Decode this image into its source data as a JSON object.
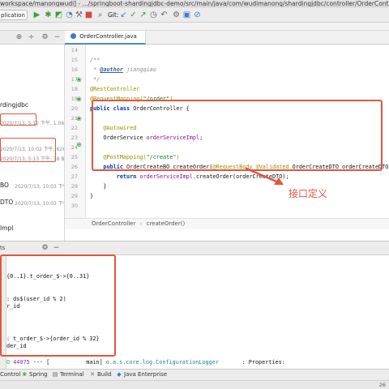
{
  "title_bar": {
    "text": "workspace/manongwudi] - .../springboot-shardingjdbc-demo/src/main/java/com/wudimanong/shardingjdbc/controller/OrderController.java [spring"
  },
  "toolbar": {
    "run_config": "plication",
    "git_label": "Git:",
    "icons": [
      "run-icon",
      "debug-icon",
      "coverage-icon",
      "profile-icon",
      "build-icon",
      "stop-icon",
      "search-icon",
      "git-update-icon",
      "git-commit-icon",
      "git-push-icon",
      "history-icon",
      "revert-icon",
      "settings-icon",
      "layout-icon",
      "block-icon"
    ]
  },
  "project_pane": {
    "header_icons": [
      "scope-icon",
      "split-icon",
      "gear-icon",
      "minimize-icon"
    ],
    "module_name": "rdingjdbc",
    "entries": [
      {
        "meta": "2020/7/13, ",
        "meta_highlight": "5:12 下午, 1.06"
      },
      {
        "meta": "2020/7/13, 10:02 下午, 626 B"
      },
      {
        "meta": "2020/7/13, 5:13 下午, 38 B"
      }
    ],
    "files": [
      {
        "name": "BO",
        "meta": "2020/7/13, 10:03 下午, 1"
      },
      {
        "name": "DTO",
        "meta": "2020/7/13, 10:03 下午,"
      },
      {
        "name": "Impl",
        "meta": ""
      }
    ]
  },
  "editor": {
    "tab_label": "OrderController.java",
    "line_numbers": [
      "14",
      "15",
      "16",
      "17",
      "18",
      "19",
      "20",
      "21",
      "22",
      "23",
      "24",
      "25",
      "26",
      "27",
      "28",
      "29",
      "30"
    ],
    "lines": {
      "l15": "/**",
      "l16_prefix": " * ",
      "l16_tag": "@author",
      "l16_rest": " jiangqiao",
      "l17": " */",
      "l18": "@RestController",
      "l19_ann": "@RequestMapping(",
      "l19_str": "\"/order\"",
      "l19_end": ")",
      "l20_kw": "public class",
      "l20_rest": " OrderController {",
      "l22": "    @Autowired",
      "l23_type": "    OrderService ",
      "l23_field": "orderServiceImpl",
      "l23_end": ";",
      "l25_ann": "    @PostMapping(",
      "l25_str": "\"/create\"",
      "l25_end": ")",
      "l26_kw": "    public",
      "l26_rest1": " OrderCreateBO createOrder(",
      "l26_ann": "@RequestBody @Validated",
      "l26_rest2": " OrderCreateDTO orderCreateDTO) {",
      "l27_kw": "        return",
      "l27_field": " orderServiceImpl",
      "l27_rest": ".createOrder(orderCreateDTO);",
      "l28": "    }",
      "l29": "}"
    }
  },
  "breadcrumb": {
    "class": "OrderController",
    "separator": "›",
    "method": "createOrder()"
  },
  "callout": {
    "text": "接口定义"
  },
  "run_panel": {
    "header_label": "ts",
    "header_icons": [
      "gear-icon",
      "minimize-icon"
    ],
    "output": [
      "{0..1}.t_order_$->{0..31}",
      ": ds$(user_id % 2)",
      "r_id",
      ": t_order_$->{order_id % 32}",
      "der_id"
    ],
    "log_line": {
      "level": "O",
      "pid": "44075",
      "sep": " --- [",
      "thread": "           main]",
      "logger": " o.a.s.core.log.ConfigurationLogger",
      "message": "       : Properties:"
    }
  },
  "bottom_bar": {
    "items": [
      {
        "label": "Control",
        "icon": "vcs-icon"
      },
      {
        "label": "Spring",
        "icon": "spring-icon"
      },
      {
        "label": "Terminal",
        "icon": "terminal-icon"
      },
      {
        "label": "Build",
        "icon": "build-icon"
      },
      {
        "label": "Java Enterprise",
        "icon": "java-enterprise-icon"
      }
    ]
  },
  "status_bar": {
    "right_text": "26"
  },
  "colors": {
    "highlight": "#e2553f",
    "annotation": "#9b8a00",
    "keyword": "#0033b3",
    "string": "#067d17",
    "field": "#871094"
  }
}
